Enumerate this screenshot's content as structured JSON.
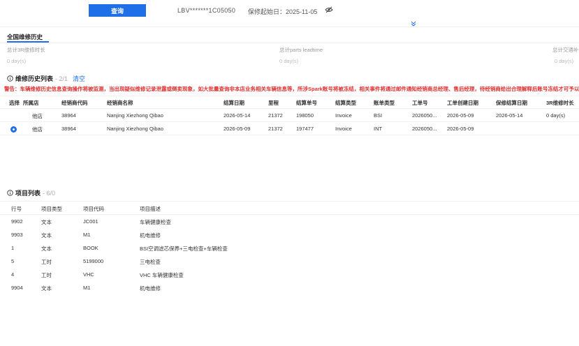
{
  "toolbar": {
    "query_label": "查询",
    "vin": "LBV*******1C05050",
    "warranty_start": "保修起始日：2025-11-05"
  },
  "tab": {
    "label": "全国维修历史"
  },
  "stats": [
    {
      "label": "总计3R维修时长",
      "value": "0 day(s)"
    },
    {
      "label": "总计parts leadtime",
      "value": "0 day(s)"
    },
    {
      "label": "总计交通补",
      "value": "0 day(s)"
    }
  ],
  "history": {
    "title": "维修历史列表",
    "count": " - 2/1",
    "clear_label": "清空",
    "warning": "警告：车辆维修历史信息查询操作将被监测，当出现疑似维修记录泄露或倒卖现象，如大批量查询非本店业务相关车辆信息等，所涉Spark账号将被冻结，相关事件将通过邮件通知经销商总经理、售后经理，待经销商给出合理解释后账号冻结才可予以解",
    "columns": [
      "选择",
      "所属店",
      "经销商代码",
      "经销商名称",
      "结算日期",
      "里程",
      "结算单号",
      "结算类型",
      "账单类型",
      "工单号",
      "工单创建日期",
      "保修结算日期",
      "3R维修时长"
    ],
    "rows": [
      {
        "selected": false,
        "store": "他店",
        "dealer_code": "38964",
        "dealer_name": "Nanjing Xiezhong Qibao",
        "settle_date": "2026-05-14",
        "mileage": "21372",
        "settle_no": "198050",
        "settle_type": "Invoice",
        "bill_type": "BSI",
        "wo_no": "2026050...",
        "wo_date": "2026-05-09",
        "warranty_date": "2026-05-14",
        "duration": "0 day(s)"
      },
      {
        "selected": true,
        "store": "他店",
        "dealer_code": "38964",
        "dealer_name": "Nanjing Xiezhong Qibao",
        "settle_date": "2026-05-09",
        "mileage": "21372",
        "settle_no": "197477",
        "settle_type": "Invoice",
        "bill_type": "INT",
        "wo_no": "2026050...",
        "wo_date": "2026-05-09",
        "warranty_date": "",
        "duration": ""
      }
    ]
  },
  "items": {
    "title": "项目列表",
    "count": " - 6/0",
    "columns": [
      "行号",
      "项目类型",
      "项目代码",
      "项目描述"
    ],
    "rows": [
      {
        "line": "9902",
        "type": "文本",
        "code": "JC001",
        "desc": "车辆健康检查"
      },
      {
        "line": "9903",
        "type": "文本",
        "code": "M1",
        "desc": "机电维修"
      },
      {
        "line": "1",
        "type": "文本",
        "code": "BOOK",
        "desc": "BSI空调滤芯保养+三电检查+车辆检查"
      },
      {
        "line": "5",
        "type": "工时",
        "code": "5199000",
        "desc": "三电检查"
      },
      {
        "line": "4",
        "type": "工时",
        "code": "VHC",
        "desc": "VHC 车辆健康检查"
      },
      {
        "line": "9904",
        "type": "文本",
        "code": "M1",
        "desc": "机电维修"
      }
    ]
  },
  "colors": {
    "accent": "#1f6fe8",
    "warning": "#e03030"
  }
}
